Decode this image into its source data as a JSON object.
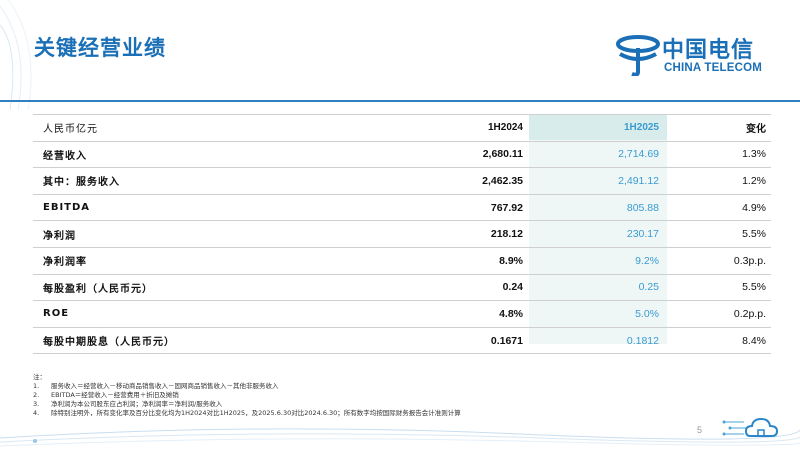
{
  "title": "关键经营业绩",
  "logo": {
    "cn": "中国电信",
    "en": "CHINA TELECOM",
    "icon": "china-telecom-logo-icon",
    "brand_color": "#1b6fb6"
  },
  "table": {
    "header": {
      "label": "人民币亿元",
      "col1": "1H2024",
      "col2": "1H2025",
      "col3": "变化"
    },
    "rows": [
      {
        "label": "经营收入",
        "v1": "2,680.11",
        "v2": "2,714.69",
        "v3": "1.3%"
      },
      {
        "label": "其中：服务收入",
        "v1": "2,462.35",
        "v2": "2,491.12",
        "v3": "1.2%"
      },
      {
        "label": "EBITDA",
        "v1": "767.92",
        "v2": "805.88",
        "v3": "4.9%"
      },
      {
        "label": "净利润",
        "v1": "218.12",
        "v2": "230.17",
        "v3": "5.5%"
      },
      {
        "label": "净利润率",
        "v1": "8.9%",
        "v2": "9.2%",
        "v3": "0.3p.p."
      },
      {
        "label": "每股盈利（人民币元）",
        "v1": "0.24",
        "v2": "0.25",
        "v3": "5.5%"
      },
      {
        "label": "ROE",
        "v1": "4.8%",
        "v2": "5.0%",
        "v3": "0.2p.p."
      },
      {
        "label": "每股中期股息（人民币元）",
        "v1": "0.1671",
        "v2": "0.1812",
        "v3": "8.4%"
      }
    ],
    "highlight_color": "#3a9bd0"
  },
  "notes": {
    "heading": "注：",
    "items": [
      {
        "num": "1.",
        "text": "服务收入＝经营收入－移动商品销售收入－固网商品销售收入－其他非服务收入"
      },
      {
        "num": "2.",
        "text": "EBITDA＝经营收入－经营费用＋折旧及摊销"
      },
      {
        "num": "3.",
        "text": "净利润为本公司股东应占利润；净利润率＝净利润/服务收入"
      },
      {
        "num": "4.",
        "text": "除特别注明外，所有变化率及百分比变化均为1H2024对比1H2025，及2025.6.30对比2024.6.30；所有数字均按国际财务报告会计准则计算"
      }
    ]
  },
  "page_number": "5"
}
